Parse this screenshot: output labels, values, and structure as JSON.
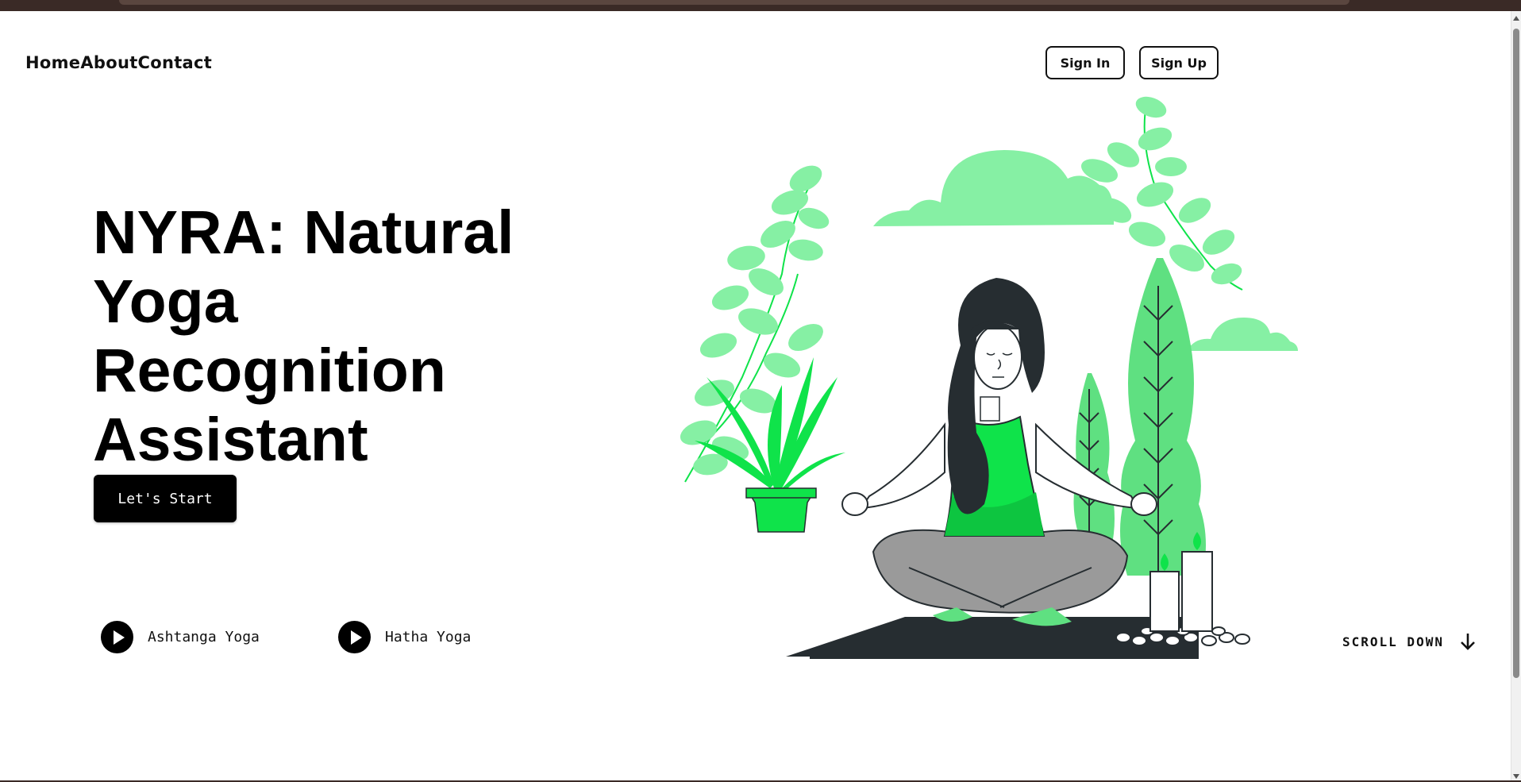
{
  "nav": {
    "items": [
      {
        "label": "Home"
      },
      {
        "label": "About"
      },
      {
        "label": "Contact"
      }
    ]
  },
  "auth": {
    "sign_in": "Sign In",
    "sign_up": "Sign Up"
  },
  "hero": {
    "title_lines": [
      "NYRA: Natural",
      "Yoga",
      "Recognition",
      "Assistant"
    ],
    "start_button": "Let's Start"
  },
  "yoga_types": [
    {
      "label": "Ashtanga Yoga",
      "icon": "play-icon"
    },
    {
      "label": "Hatha Yoga",
      "icon": "play-icon"
    }
  ],
  "scroll": {
    "label": "SCROLL DOWN",
    "icon": "arrow-down-icon"
  },
  "illustration": {
    "subject": "meditating-woman-illustration"
  },
  "colors": {
    "accent_green": "#0fe34a",
    "light_green": "#86f0a4",
    "mid_green": "#5fe081",
    "dark": "#262d31",
    "gray_pants": "#9a9a9a",
    "button_bg": "#000000"
  }
}
